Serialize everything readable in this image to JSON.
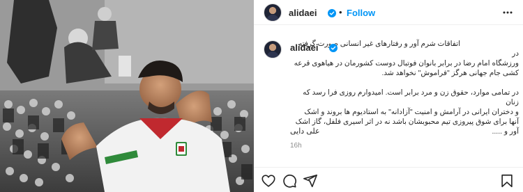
{
  "post": {
    "username": "alidaei",
    "verified": true,
    "follow_label": "Follow",
    "separator": "•",
    "caption_lines": [
      "اتفاقات شرم آور و رفتارهای غیر انسانی صورت گرفته در",
      "ورزشگاه امام رضا در برابر بانوان فوتبال دوست کشورمان در هیاهوی قرعه",
      "کشی جام جهانی هرگز \"فراموش\" نخواهد شد.",
      "در تمامی موارد، حقوق زن و مرد برابر است. امیدوارم روزی فرا رسد که زنان",
      "و دختران ایرانی در آرامش و امنیت \"آزادانه\" به استادیوم ها بروند و اشک",
      "آنها برای شوق پیروزی تیم محبوبشان باشد نه در اثر اسیری فلفل، گاز اشک",
      "آور و ....."
    ],
    "signature": "علی دایی",
    "timestamp": "16h"
  },
  "icons": {
    "more": "more-options-icon",
    "like": "heart-icon",
    "comment": "comment-icon",
    "share": "share-icon",
    "save": "bookmark-icon",
    "verified": "verified-badge-icon"
  },
  "colors": {
    "accent": "#0095f6",
    "text": "#262626",
    "muted": "#8e8e8e",
    "border": "#efefef"
  }
}
